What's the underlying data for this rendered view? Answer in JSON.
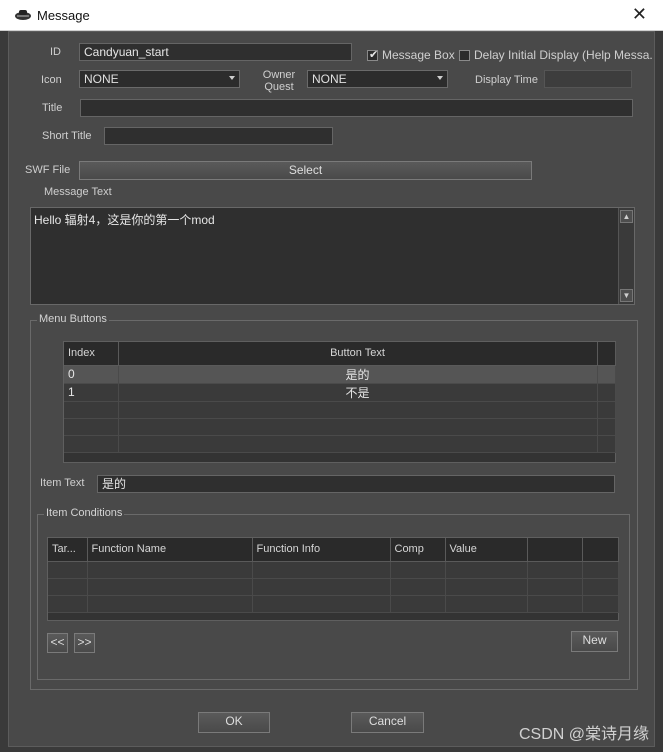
{
  "window": {
    "title": "Message",
    "close_glyph": "✕"
  },
  "form": {
    "id_label": "ID",
    "id_value": "Candyuan_start",
    "message_box_label": "Message Box",
    "message_box_checked": true,
    "delay_initial_label": "Delay Initial Display (Help Messa.",
    "delay_initial_checked": false,
    "icon_label": "Icon",
    "icon_value": "NONE",
    "owner_quest_label_1": "Owner",
    "owner_quest_label_2": "Quest",
    "owner_quest_value": "NONE",
    "display_time_label": "Display Time",
    "display_time_value": "",
    "title_label": "Title",
    "title_value": "",
    "short_title_label": "Short Title",
    "short_title_value": "",
    "swf_file_label": "SWF File",
    "swf_select_label": "Select",
    "message_text_label": "Message Text",
    "message_text_value": "Hello 辐射4，这是你的第一个mod"
  },
  "menu_buttons": {
    "group_label": "Menu Buttons",
    "columns": [
      "Index",
      "Button Text"
    ],
    "rows": [
      {
        "index": "0",
        "text": "是的"
      },
      {
        "index": "1",
        "text": "不是"
      }
    ],
    "item_text_label": "Item Text",
    "item_text_value": "是的"
  },
  "item_conditions": {
    "group_label": "Item Conditions",
    "columns": [
      "Tar...",
      "Function Name",
      "Function Info",
      "Comp",
      "Value",
      ""
    ],
    "prev_label": "<<",
    "next_label": ">>",
    "new_label": "New"
  },
  "footer": {
    "ok_label": "OK",
    "cancel_label": "Cancel"
  },
  "watermark": "CSDN @棠诗月缘",
  "colors": {
    "dialog_bg": "#494949",
    "field_bg": "#2f2f2f",
    "titlebar_bg": "#ffffff"
  }
}
